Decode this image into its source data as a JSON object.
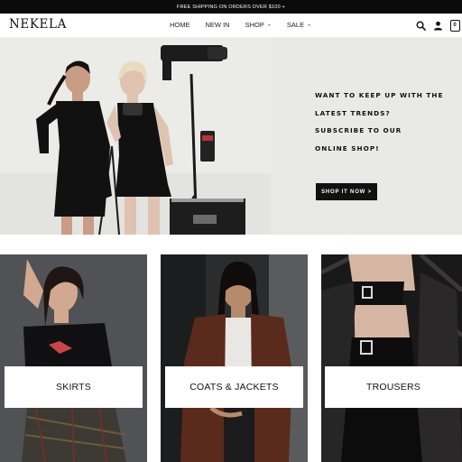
{
  "announcement": {
    "text": "FREE SHIPPING ON ORDERS OVER $100 +"
  },
  "header": {
    "logo": "NEKELA",
    "nav": [
      {
        "label": "HOME",
        "has_dropdown": false
      },
      {
        "label": "NEW IN",
        "has_dropdown": false
      },
      {
        "label": "SHOP",
        "has_dropdown": true
      },
      {
        "label": "SALE",
        "has_dropdown": true
      }
    ],
    "icons": {
      "search": "search-icon",
      "account": "account-icon",
      "cart": "cart-icon"
    },
    "cart_count": "0"
  },
  "hero": {
    "lines": [
      "WANT TO KEEP UP WITH THE",
      "LATEST TRENDS?",
      "SUBSCRIBE TO OUR",
      "ONLINE SHOP!"
    ],
    "cta_label": "SHOP IT NOW >"
  },
  "categories": [
    {
      "label": "SKIRTS"
    },
    {
      "label": "COATS & JACKETS"
    },
    {
      "label": "TROUSERS"
    }
  ],
  "colors": {
    "announcement_bg": "#0b0b0b",
    "cta_bg": "#111111",
    "hero_bg": "#e9e9e6"
  }
}
